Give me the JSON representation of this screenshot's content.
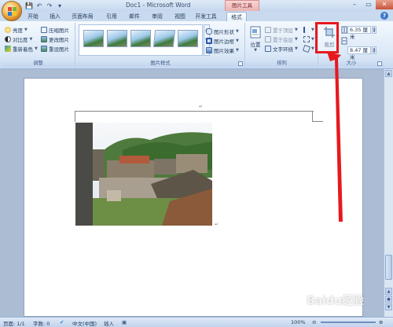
{
  "window": {
    "title": "Doc1 - Microsoft Word",
    "context_group": "图片工具",
    "controls": [
      "–",
      "▭",
      "✕"
    ]
  },
  "tabs": [
    "开始",
    "插入",
    "页面布局",
    "引用",
    "邮件",
    "审阅",
    "视图",
    "开发工具",
    "格式"
  ],
  "active_tab": "格式",
  "ribbon": {
    "adjust": {
      "label": "调整",
      "brightness": "亮度",
      "contrast": "对比度",
      "recolor": "重新着色",
      "compress": "压缩图片",
      "change_picture": "更改图片",
      "reset_picture": "重设图片"
    },
    "styles": {
      "label": "图片样式",
      "shape": "图片形状",
      "border": "图片边框",
      "effects": "图片效果"
    },
    "arrange": {
      "label": "排列",
      "position": "位置",
      "bring_front": "置于顶层",
      "send_back": "置于底层",
      "text_wrap": "文字环绕"
    },
    "size": {
      "label": "大小",
      "crop": "裁剪",
      "height": "6.35 厘米",
      "width": "8.47 厘米"
    }
  },
  "statusbar": {
    "page": "页面: 1/1",
    "words": "字数: 0",
    "language": "中文(中国)",
    "mode": "插入",
    "zoom": "100%"
  },
  "watermark": "Baidu经验",
  "colors": {
    "highlight": "#e6191e",
    "ribbon_bg": "#dbe8f7",
    "context_tab": "#eab2b2"
  }
}
